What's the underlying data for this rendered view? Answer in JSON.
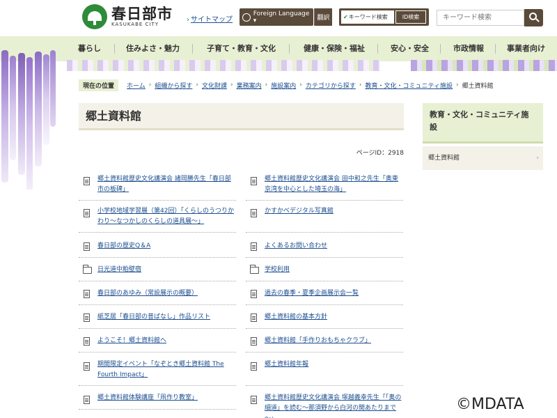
{
  "header": {
    "logo_main": "春日部市",
    "logo_sub": "KASUKABE CITY",
    "sitemap": "サイトマップ",
    "foreign_language": "Foreign Language ▾",
    "translate": "翻訳",
    "mode_keyword": "キーワード検索",
    "mode_id": "ID検索",
    "search_placeholder": "キーワード検索"
  },
  "nav": {
    "items": [
      "暮らし",
      "住みよさ・魅力",
      "子育て・教育・文化",
      "健康・保険・福祉",
      "安心・安全",
      "市政情報",
      "事業者向け"
    ]
  },
  "breadcrumb": {
    "label": "現在の位置",
    "items": [
      "ホーム",
      "組織から探す",
      "文化財課",
      "業務案内",
      "施設案内",
      "カテゴリから探す",
      "教育・文化・コミュニティ施設"
    ],
    "current": "郷土資料館"
  },
  "page": {
    "title": "郷土資料館",
    "page_id": "ページID：2918"
  },
  "links": {
    "rows": [
      [
        {
          "icon": "doc",
          "text": "郷土資料館歴史文化講演会 諸岡勝先生「春日部市の板碑」"
        },
        {
          "icon": "doc",
          "text": "郷土資料館歴史文化講演会 田中和之先生「奥東京湾を中心とした埼玉の海」"
        }
      ],
      [
        {
          "icon": "doc",
          "text": "小学校地域学習展（第42回）「くらしのうつりかわり～なつかしのくらしの道具展～」"
        },
        {
          "icon": "doc",
          "text": "かすかべデジタル写真館"
        }
      ],
      [
        {
          "icon": "doc",
          "text": "春日部の歴史Q＆A"
        },
        {
          "icon": "doc",
          "text": "よくあるお問い合わせ"
        }
      ],
      [
        {
          "icon": "folder",
          "text": "日光道中粕壁宿"
        },
        {
          "icon": "folder",
          "text": "学校利用"
        }
      ],
      [
        {
          "icon": "doc",
          "text": "春日部のあゆみ（常設展示の概要）"
        },
        {
          "icon": "doc",
          "text": "過去の春季・夏季企画展示会一覧"
        }
      ],
      [
        {
          "icon": "doc",
          "text": "紙芝居「春日部の昔ばなし」作品リスト"
        },
        {
          "icon": "doc",
          "text": "郷土資料館の基本方針"
        }
      ],
      [
        {
          "icon": "doc",
          "text": "ようこそ！郷土資料館へ"
        },
        {
          "icon": "doc",
          "text": "郷土資料館「手作りおもちゃクラブ」"
        }
      ],
      [
        {
          "icon": "doc",
          "text": "期間限定イベント「なぞとき郷土資料館 The Fourth Impact」"
        },
        {
          "icon": "doc",
          "text": "郷土資料館年報"
        }
      ],
      [
        {
          "icon": "doc",
          "text": "郷土資料館体験講座「凧作り教室」"
        },
        {
          "icon": "doc",
          "text": "郷土資料館歴史文化講演会 塚越義幸先生「「奥の細道」を読む～那須野から白河の関あたりまで～」"
        }
      ]
    ]
  },
  "sidebar": {
    "heading": "教育・文化・コミュニティ施設",
    "items": [
      "郷土資料館"
    ]
  },
  "watermark": "©MDATA"
}
